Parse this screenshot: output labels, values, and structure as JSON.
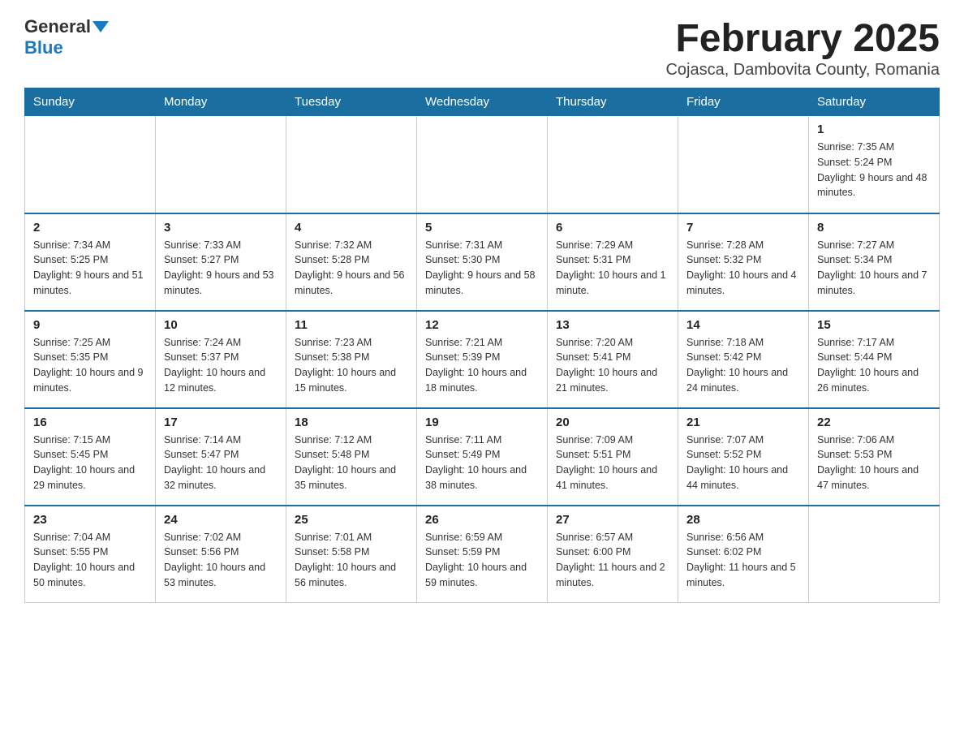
{
  "header": {
    "logo_general": "General",
    "logo_blue": "Blue",
    "month_title": "February 2025",
    "location": "Cojasca, Dambovita County, Romania"
  },
  "days_of_week": [
    "Sunday",
    "Monday",
    "Tuesday",
    "Wednesday",
    "Thursday",
    "Friday",
    "Saturday"
  ],
  "weeks": [
    {
      "days": [
        {
          "number": "",
          "info": ""
        },
        {
          "number": "",
          "info": ""
        },
        {
          "number": "",
          "info": ""
        },
        {
          "number": "",
          "info": ""
        },
        {
          "number": "",
          "info": ""
        },
        {
          "number": "",
          "info": ""
        },
        {
          "number": "1",
          "info": "Sunrise: 7:35 AM\nSunset: 5:24 PM\nDaylight: 9 hours and 48 minutes."
        }
      ]
    },
    {
      "days": [
        {
          "number": "2",
          "info": "Sunrise: 7:34 AM\nSunset: 5:25 PM\nDaylight: 9 hours and 51 minutes."
        },
        {
          "number": "3",
          "info": "Sunrise: 7:33 AM\nSunset: 5:27 PM\nDaylight: 9 hours and 53 minutes."
        },
        {
          "number": "4",
          "info": "Sunrise: 7:32 AM\nSunset: 5:28 PM\nDaylight: 9 hours and 56 minutes."
        },
        {
          "number": "5",
          "info": "Sunrise: 7:31 AM\nSunset: 5:30 PM\nDaylight: 9 hours and 58 minutes."
        },
        {
          "number": "6",
          "info": "Sunrise: 7:29 AM\nSunset: 5:31 PM\nDaylight: 10 hours and 1 minute."
        },
        {
          "number": "7",
          "info": "Sunrise: 7:28 AM\nSunset: 5:32 PM\nDaylight: 10 hours and 4 minutes."
        },
        {
          "number": "8",
          "info": "Sunrise: 7:27 AM\nSunset: 5:34 PM\nDaylight: 10 hours and 7 minutes."
        }
      ]
    },
    {
      "days": [
        {
          "number": "9",
          "info": "Sunrise: 7:25 AM\nSunset: 5:35 PM\nDaylight: 10 hours and 9 minutes."
        },
        {
          "number": "10",
          "info": "Sunrise: 7:24 AM\nSunset: 5:37 PM\nDaylight: 10 hours and 12 minutes."
        },
        {
          "number": "11",
          "info": "Sunrise: 7:23 AM\nSunset: 5:38 PM\nDaylight: 10 hours and 15 minutes."
        },
        {
          "number": "12",
          "info": "Sunrise: 7:21 AM\nSunset: 5:39 PM\nDaylight: 10 hours and 18 minutes."
        },
        {
          "number": "13",
          "info": "Sunrise: 7:20 AM\nSunset: 5:41 PM\nDaylight: 10 hours and 21 minutes."
        },
        {
          "number": "14",
          "info": "Sunrise: 7:18 AM\nSunset: 5:42 PM\nDaylight: 10 hours and 24 minutes."
        },
        {
          "number": "15",
          "info": "Sunrise: 7:17 AM\nSunset: 5:44 PM\nDaylight: 10 hours and 26 minutes."
        }
      ]
    },
    {
      "days": [
        {
          "number": "16",
          "info": "Sunrise: 7:15 AM\nSunset: 5:45 PM\nDaylight: 10 hours and 29 minutes."
        },
        {
          "number": "17",
          "info": "Sunrise: 7:14 AM\nSunset: 5:47 PM\nDaylight: 10 hours and 32 minutes."
        },
        {
          "number": "18",
          "info": "Sunrise: 7:12 AM\nSunset: 5:48 PM\nDaylight: 10 hours and 35 minutes."
        },
        {
          "number": "19",
          "info": "Sunrise: 7:11 AM\nSunset: 5:49 PM\nDaylight: 10 hours and 38 minutes."
        },
        {
          "number": "20",
          "info": "Sunrise: 7:09 AM\nSunset: 5:51 PM\nDaylight: 10 hours and 41 minutes."
        },
        {
          "number": "21",
          "info": "Sunrise: 7:07 AM\nSunset: 5:52 PM\nDaylight: 10 hours and 44 minutes."
        },
        {
          "number": "22",
          "info": "Sunrise: 7:06 AM\nSunset: 5:53 PM\nDaylight: 10 hours and 47 minutes."
        }
      ]
    },
    {
      "days": [
        {
          "number": "23",
          "info": "Sunrise: 7:04 AM\nSunset: 5:55 PM\nDaylight: 10 hours and 50 minutes."
        },
        {
          "number": "24",
          "info": "Sunrise: 7:02 AM\nSunset: 5:56 PM\nDaylight: 10 hours and 53 minutes."
        },
        {
          "number": "25",
          "info": "Sunrise: 7:01 AM\nSunset: 5:58 PM\nDaylight: 10 hours and 56 minutes."
        },
        {
          "number": "26",
          "info": "Sunrise: 6:59 AM\nSunset: 5:59 PM\nDaylight: 10 hours and 59 minutes."
        },
        {
          "number": "27",
          "info": "Sunrise: 6:57 AM\nSunset: 6:00 PM\nDaylight: 11 hours and 2 minutes."
        },
        {
          "number": "28",
          "info": "Sunrise: 6:56 AM\nSunset: 6:02 PM\nDaylight: 11 hours and 5 minutes."
        },
        {
          "number": "",
          "info": ""
        }
      ]
    }
  ]
}
